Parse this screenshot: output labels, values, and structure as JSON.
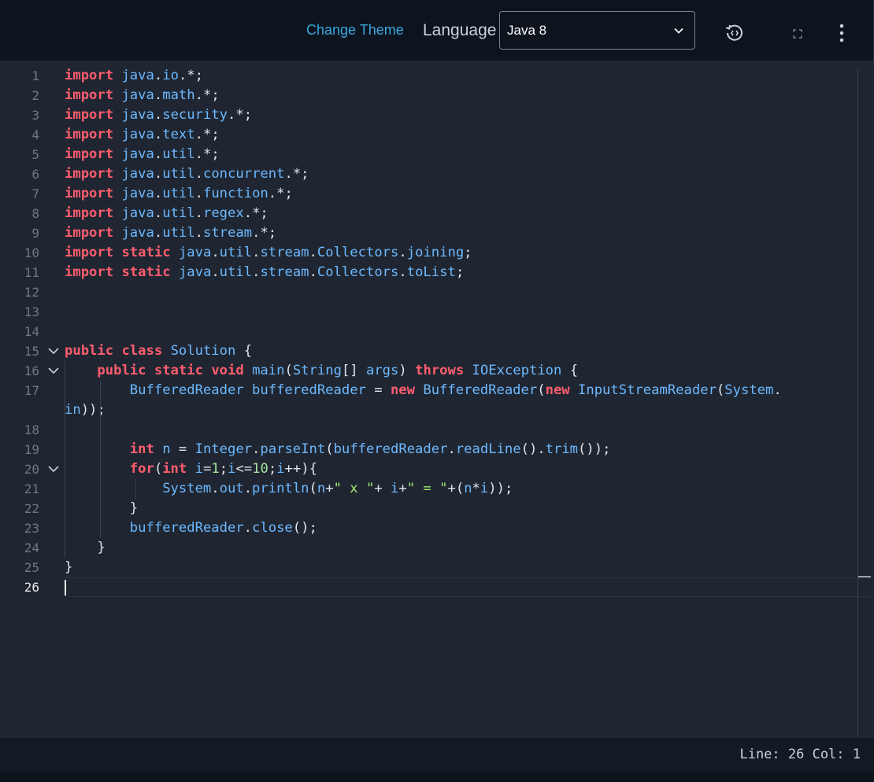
{
  "toolbar": {
    "change_theme": "Change Theme",
    "language_label": "Language",
    "language_value": "Java 8",
    "icons": [
      "restore-icon",
      "fullscreen-icon",
      "more-vertical-icon"
    ]
  },
  "editor": {
    "line_numbers": [
      "1",
      "2",
      "3",
      "4",
      "5",
      "6",
      "7",
      "8",
      "9",
      "10",
      "11",
      "12",
      "13",
      "14",
      "15",
      "16",
      "17",
      "18",
      "19",
      "20",
      "21",
      "22",
      "23",
      "24",
      "25",
      "26"
    ],
    "lines": [
      [
        [
          "kw",
          "import"
        ],
        [
          "plain",
          " "
        ],
        [
          "id",
          "java"
        ],
        [
          "plain",
          "."
        ],
        [
          "id",
          "io"
        ],
        [
          "plain",
          ".*;"
        ]
      ],
      [
        [
          "kw",
          "import"
        ],
        [
          "plain",
          " "
        ],
        [
          "id",
          "java"
        ],
        [
          "plain",
          "."
        ],
        [
          "id",
          "math"
        ],
        [
          "plain",
          ".*;"
        ]
      ],
      [
        [
          "kw",
          "import"
        ],
        [
          "plain",
          " "
        ],
        [
          "id",
          "java"
        ],
        [
          "plain",
          "."
        ],
        [
          "id",
          "security"
        ],
        [
          "plain",
          ".*;"
        ]
      ],
      [
        [
          "kw",
          "import"
        ],
        [
          "plain",
          " "
        ],
        [
          "id",
          "java"
        ],
        [
          "plain",
          "."
        ],
        [
          "id",
          "text"
        ],
        [
          "plain",
          ".*;"
        ]
      ],
      [
        [
          "kw",
          "import"
        ],
        [
          "plain",
          " "
        ],
        [
          "id",
          "java"
        ],
        [
          "plain",
          "."
        ],
        [
          "id",
          "util"
        ],
        [
          "plain",
          ".*;"
        ]
      ],
      [
        [
          "kw",
          "import"
        ],
        [
          "plain",
          " "
        ],
        [
          "id",
          "java"
        ],
        [
          "plain",
          "."
        ],
        [
          "id",
          "util"
        ],
        [
          "plain",
          "."
        ],
        [
          "id",
          "concurrent"
        ],
        [
          "plain",
          ".*;"
        ]
      ],
      [
        [
          "kw",
          "import"
        ],
        [
          "plain",
          " "
        ],
        [
          "id",
          "java"
        ],
        [
          "plain",
          "."
        ],
        [
          "id",
          "util"
        ],
        [
          "plain",
          "."
        ],
        [
          "id",
          "function"
        ],
        [
          "plain",
          ".*;"
        ]
      ],
      [
        [
          "kw",
          "import"
        ],
        [
          "plain",
          " "
        ],
        [
          "id",
          "java"
        ],
        [
          "plain",
          "."
        ],
        [
          "id",
          "util"
        ],
        [
          "plain",
          "."
        ],
        [
          "id",
          "regex"
        ],
        [
          "plain",
          ".*;"
        ]
      ],
      [
        [
          "kw",
          "import"
        ],
        [
          "plain",
          " "
        ],
        [
          "id",
          "java"
        ],
        [
          "plain",
          "."
        ],
        [
          "id",
          "util"
        ],
        [
          "plain",
          "."
        ],
        [
          "id",
          "stream"
        ],
        [
          "plain",
          ".*;"
        ]
      ],
      [
        [
          "kw",
          "import"
        ],
        [
          "plain",
          " "
        ],
        [
          "kw",
          "static"
        ],
        [
          "plain",
          " "
        ],
        [
          "id",
          "java"
        ],
        [
          "plain",
          "."
        ],
        [
          "id",
          "util"
        ],
        [
          "plain",
          "."
        ],
        [
          "id",
          "stream"
        ],
        [
          "plain",
          "."
        ],
        [
          "id",
          "Collectors"
        ],
        [
          "plain",
          "."
        ],
        [
          "id",
          "joining"
        ],
        [
          "plain",
          ";"
        ]
      ],
      [
        [
          "kw",
          "import"
        ],
        [
          "plain",
          " "
        ],
        [
          "kw",
          "static"
        ],
        [
          "plain",
          " "
        ],
        [
          "id",
          "java"
        ],
        [
          "plain",
          "."
        ],
        [
          "id",
          "util"
        ],
        [
          "plain",
          "."
        ],
        [
          "id",
          "stream"
        ],
        [
          "plain",
          "."
        ],
        [
          "id",
          "Collectors"
        ],
        [
          "plain",
          "."
        ],
        [
          "id",
          "toList"
        ],
        [
          "plain",
          ";"
        ]
      ],
      [],
      [],
      [],
      [
        [
          "kw",
          "public"
        ],
        [
          "plain",
          " "
        ],
        [
          "kw",
          "class"
        ],
        [
          "plain",
          " "
        ],
        [
          "id",
          "Solution"
        ],
        [
          "plain",
          " {"
        ]
      ],
      [
        [
          "plain",
          "    "
        ],
        [
          "kw",
          "public"
        ],
        [
          "plain",
          " "
        ],
        [
          "kw",
          "static"
        ],
        [
          "plain",
          " "
        ],
        [
          "kw",
          "void"
        ],
        [
          "plain",
          " "
        ],
        [
          "id",
          "main"
        ],
        [
          "plain",
          "("
        ],
        [
          "id",
          "String"
        ],
        [
          "plain",
          "[] "
        ],
        [
          "id",
          "args"
        ],
        [
          "plain",
          ") "
        ],
        [
          "kw",
          "throws"
        ],
        [
          "plain",
          " "
        ],
        [
          "id",
          "IOException"
        ],
        [
          "plain",
          " {"
        ]
      ],
      [
        [
          "plain",
          "        "
        ],
        [
          "id",
          "BufferedReader"
        ],
        [
          "plain",
          " "
        ],
        [
          "id",
          "bufferedReader"
        ],
        [
          "plain",
          " = "
        ],
        [
          "kw",
          "new"
        ],
        [
          "plain",
          " "
        ],
        [
          "id",
          "BufferedReader"
        ],
        [
          "plain",
          "("
        ],
        [
          "kw",
          "new"
        ],
        [
          "plain",
          " "
        ],
        [
          "id",
          "InputStreamReader"
        ],
        [
          "plain",
          "("
        ],
        [
          "id",
          "System"
        ],
        [
          "plain",
          "."
        ]
      ],
      [
        [
          "id",
          "in"
        ],
        [
          "plain",
          "));"
        ]
      ],
      [],
      [
        [
          "plain",
          "        "
        ],
        [
          "kw",
          "int"
        ],
        [
          "plain",
          " "
        ],
        [
          "id",
          "n"
        ],
        [
          "plain",
          " = "
        ],
        [
          "id",
          "Integer"
        ],
        [
          "plain",
          "."
        ],
        [
          "id",
          "parseInt"
        ],
        [
          "plain",
          "("
        ],
        [
          "id",
          "bufferedReader"
        ],
        [
          "plain",
          "."
        ],
        [
          "id",
          "readLine"
        ],
        [
          "plain",
          "()."
        ],
        [
          "id",
          "trim"
        ],
        [
          "plain",
          "());"
        ]
      ],
      [
        [
          "plain",
          "        "
        ],
        [
          "kw",
          "for"
        ],
        [
          "plain",
          "("
        ],
        [
          "kw",
          "int"
        ],
        [
          "plain",
          " "
        ],
        [
          "id",
          "i"
        ],
        [
          "plain",
          "="
        ],
        [
          "num",
          "1"
        ],
        [
          "plain",
          ";"
        ],
        [
          "id",
          "i"
        ],
        [
          "plain",
          "<="
        ],
        [
          "num",
          "10"
        ],
        [
          "plain",
          ";"
        ],
        [
          "id",
          "i"
        ],
        [
          "plain",
          "++){"
        ]
      ],
      [
        [
          "plain",
          "            "
        ],
        [
          "id",
          "System"
        ],
        [
          "plain",
          "."
        ],
        [
          "id",
          "out"
        ],
        [
          "plain",
          "."
        ],
        [
          "id",
          "println"
        ],
        [
          "plain",
          "("
        ],
        [
          "id",
          "n"
        ],
        [
          "plain",
          "+"
        ],
        [
          "str",
          "\" x \""
        ],
        [
          "plain",
          "+ "
        ],
        [
          "id",
          "i"
        ],
        [
          "plain",
          "+"
        ],
        [
          "str",
          "\" = \""
        ],
        [
          "plain",
          "+("
        ],
        [
          "id",
          "n"
        ],
        [
          "plain",
          "*"
        ],
        [
          "id",
          "i"
        ],
        [
          "plain",
          "));"
        ]
      ],
      [
        [
          "plain",
          "        }"
        ]
      ],
      [
        [
          "plain",
          "        "
        ],
        [
          "id",
          "bufferedReader"
        ],
        [
          "plain",
          "."
        ],
        [
          "id",
          "close"
        ],
        [
          "plain",
          "();"
        ]
      ],
      [
        [
          "plain",
          "    }"
        ]
      ],
      [
        [
          "plain",
          "}"
        ]
      ],
      []
    ]
  },
  "status": {
    "position": "Line: 26 Col: 1"
  },
  "colors": {
    "keyword": "#ff5d6e",
    "identifier": "#6cb8ff",
    "link": "#39a8e0",
    "editor_bg": "#1f2631"
  }
}
